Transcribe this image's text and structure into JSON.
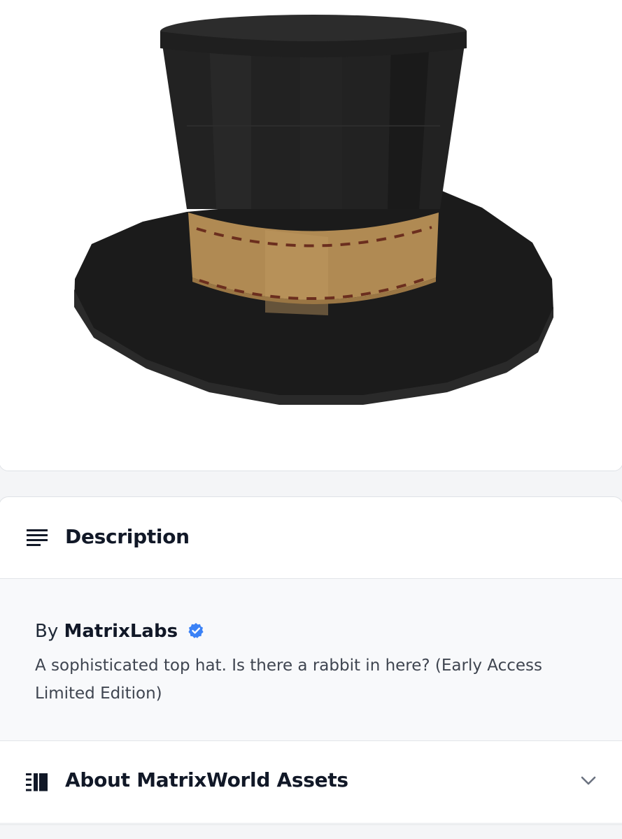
{
  "product_image": {
    "alt": "Top hat"
  },
  "description": {
    "heading": "Description",
    "by_prefix": "By",
    "creator": "MatrixLabs",
    "creator_verified": true,
    "text": "A sophisticated top hat. Is there a rabbit in here? (Early Access Limited Edition)"
  },
  "about": {
    "heading": "About MatrixWorld Assets",
    "expanded": false
  },
  "colors": {
    "verified_badge": "#3b82f6",
    "hat_band": "#b08a53",
    "hat_body": "#1c1c1c"
  },
  "icons": [
    "lines-icon",
    "verified-badge-icon",
    "catalog-icon",
    "chevron-down-icon"
  ]
}
